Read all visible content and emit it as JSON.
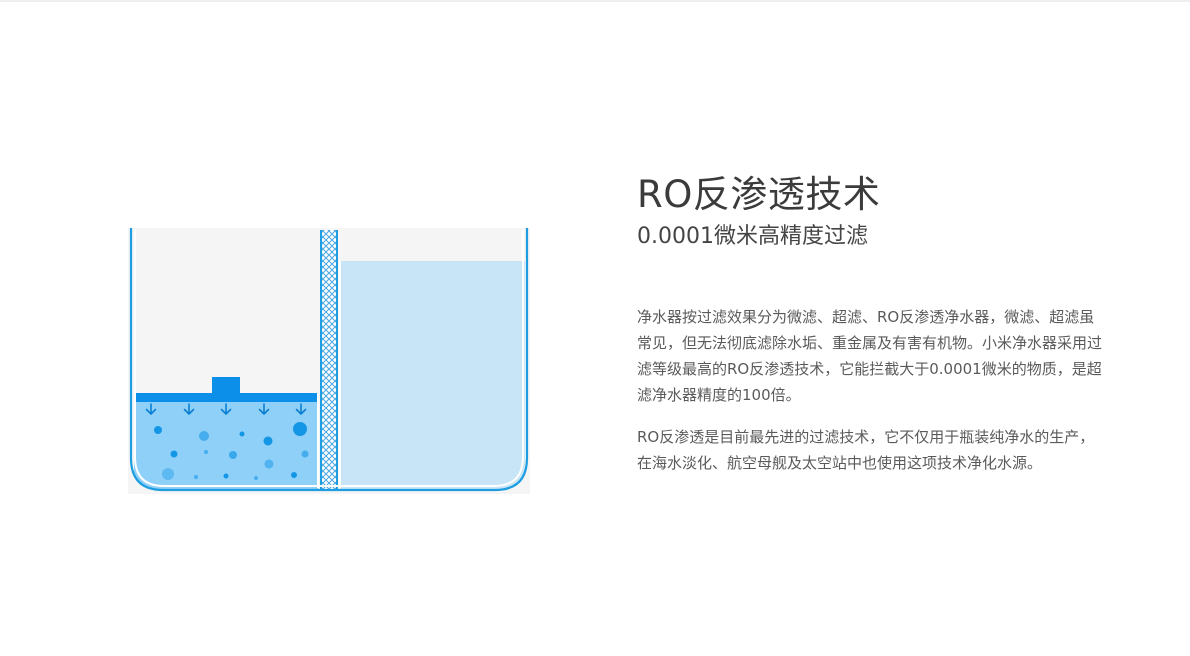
{
  "feature": {
    "title": "RO反渗透技术",
    "subtitle": "0.0001微米高精度过滤",
    "paragraphs": [
      "净水器按过滤效果分为微滤、超滤、RO反渗透净水器，微滤、超滤虽常见，但无法彻底滤除水垢、重金属及有害有机物。小米净水器采用过滤等级最高的RO反渗透技术，它能拦截大于0.0001微米的物质，是超滤净水器精度的100倍。",
      "RO反渗透是目前最先进的过滤技术，它不仅用于瓶装纯净水的生产，在海水淡化、航空母舰及太空站中也使用这项技术净化水源。"
    ]
  },
  "illustration": {
    "icon": "ro-membrane-diagram-icon",
    "colors": {
      "outline": "#1e9ee0",
      "piston": "#0b8fe8",
      "arrow": "#0b7fd4",
      "dirty_water": "#8fd0f8",
      "particle": "#1496e6",
      "clean_water": "#c8e5f8",
      "background": "#f5f5f5",
      "membrane": "#4aa8e4"
    }
  }
}
